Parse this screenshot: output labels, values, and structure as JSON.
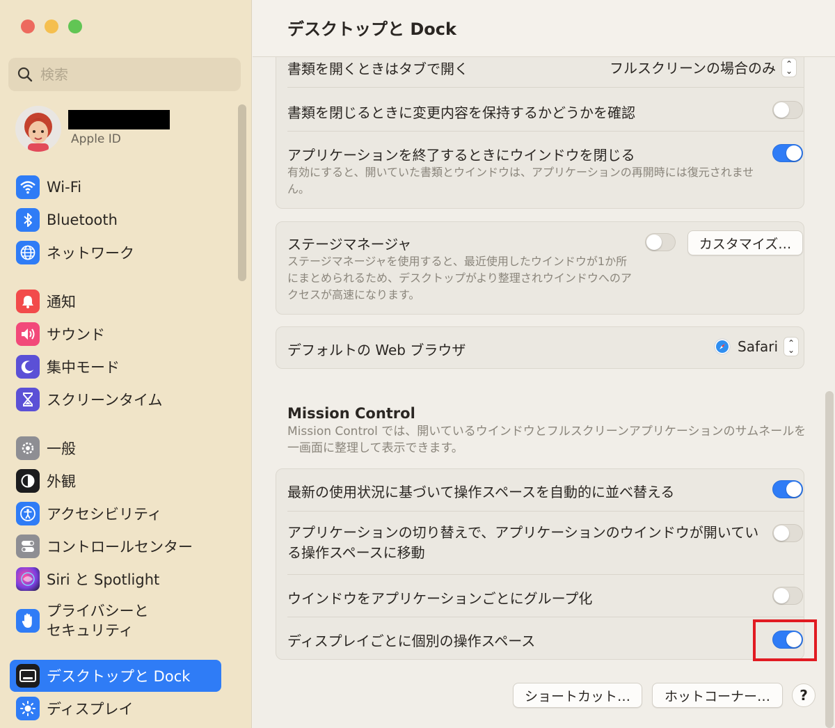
{
  "window": {
    "title": "デスクトップと Dock"
  },
  "sidebar": {
    "search_placeholder": "検索",
    "profile": {
      "sublabel": "Apple ID"
    },
    "items": [
      {
        "label": "Wi-Fi",
        "icon": "wifi-icon",
        "color": "#2f7cf6"
      },
      {
        "label": "Bluetooth",
        "icon": "bluetooth-icon",
        "color": "#2f7cf6"
      },
      {
        "label": "ネットワーク",
        "icon": "globe-icon",
        "color": "#2f7cf6"
      },
      {
        "label": "通知",
        "icon": "bell-icon",
        "color": "#f24b4b"
      },
      {
        "label": "サウンド",
        "icon": "speaker-icon",
        "color": "#f2497a"
      },
      {
        "label": "集中モード",
        "icon": "moon-icon",
        "color": "#5b50d6"
      },
      {
        "label": "スクリーンタイム",
        "icon": "hourglass-icon",
        "color": "#5b50d6"
      },
      {
        "label": "一般",
        "icon": "gear-icon",
        "color": "#8e8e93"
      },
      {
        "label": "外観",
        "icon": "appearance-icon",
        "color": "#1c1c1e"
      },
      {
        "label": "アクセシビリティ",
        "icon": "accessibility-icon",
        "color": "#2f7cf6"
      },
      {
        "label": "コントロールセンター",
        "icon": "control-center-icon",
        "color": "#8e8e93"
      },
      {
        "label": "Siri と Spotlight",
        "icon": "siri-icon",
        "color": "#8a45d6"
      },
      {
        "label": "プライバシーと\nセキュリティ",
        "icon": "hand-icon",
        "color": "#2f7cf6"
      },
      {
        "label": "デスクトップと Dock",
        "icon": "dock-icon",
        "color": "#1c1c1e",
        "selected": true
      },
      {
        "label": "ディスプレイ",
        "icon": "sun-icon",
        "color": "#2f7cf6"
      }
    ]
  },
  "settings": {
    "open_tabs": {
      "label": "書類を開くときはタブで開く",
      "value": "フルスクリーンの場合のみ"
    },
    "ask_keep_changes": {
      "label": "書類を閉じるときに変更内容を保持するかどうかを確認",
      "on": false
    },
    "close_windows": {
      "label": "アプリケーションを終了するときにウインドウを閉じる",
      "on": true,
      "desc": "有効にすると、開いていた書類とウインドウは、アプリケーションの再開時には復元されません。"
    },
    "stage_manager": {
      "label": "ステージマネージャ",
      "on": false,
      "button": "カスタマイズ…",
      "desc": "ステージマネージャを使用すると、最近使用したウインドウが1か所にまとめられるため、デスクトップがより整理されウインドウへのアクセスが高速になります。"
    },
    "default_browser": {
      "label": "デフォルトの Web ブラウザ",
      "value": "Safari"
    }
  },
  "mission_control": {
    "title": "Mission Control",
    "desc": "Mission Control では、開いているウインドウとフルスクリーンアプリケーションのサムネールを一画面に整理して表示できます。",
    "rows": [
      {
        "label": "最新の使用状況に基づいて操作スペースを自動的に並べ替える",
        "on": true
      },
      {
        "label": "アプリケーションの切り替えで、アプリケーションのウインドウが開いている操作スペースに移動",
        "on": false
      },
      {
        "label": "ウインドウをアプリケーションごとにグループ化",
        "on": false
      },
      {
        "label": "ディスプレイごとに個別の操作スペース",
        "on": true
      }
    ]
  },
  "footer": {
    "shortcuts": "ショートカット…",
    "hot_corners": "ホットコーナー…",
    "help": "?"
  },
  "colors": {
    "accent": "#2f7cf6",
    "highlight": "#e11b22"
  }
}
